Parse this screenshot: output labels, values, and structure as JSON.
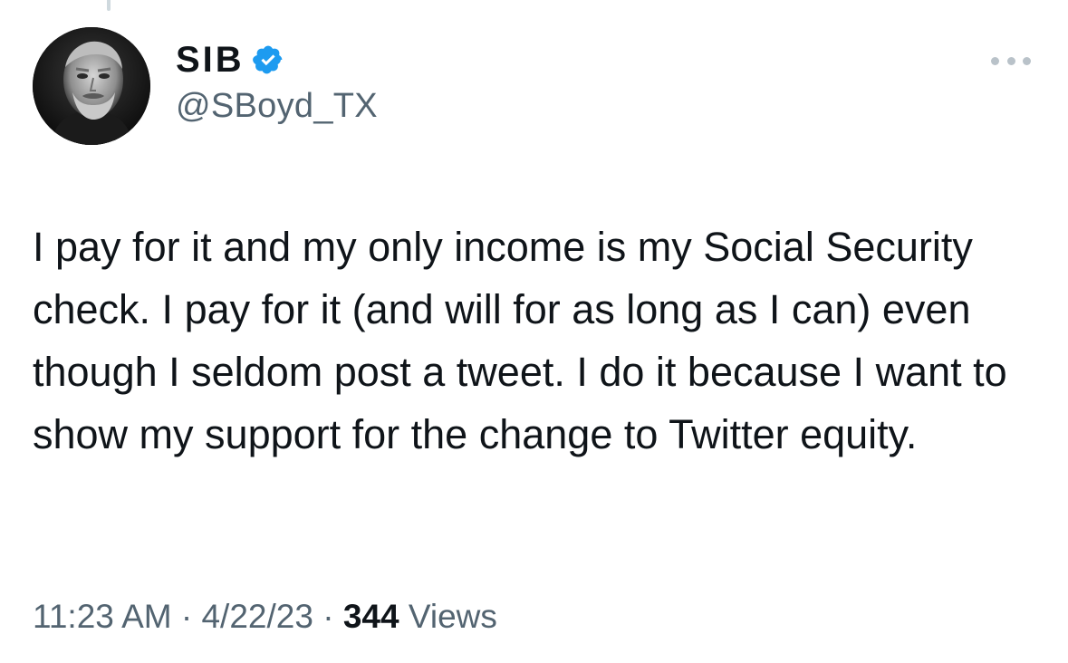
{
  "author": {
    "display_name": "SIB",
    "handle": "@SBoyd_TX",
    "verified": true,
    "avatar": "grayscale-portrait-photo"
  },
  "icons": {
    "verified": "verified-badge-icon",
    "more": "more-options-icon"
  },
  "colors": {
    "verified_badge": "#1d9bf0",
    "secondary_text": "#536471",
    "primary_text": "#0f1419"
  },
  "tweet": {
    "text": "I pay for it and my only income is my Social Security check. I pay for it (and will for as long as I can) even though I seldom post a tweet. I do it because I want to show my support for the change to Twitter equity."
  },
  "meta": {
    "time": "11:23 AM",
    "separator": "·",
    "date": "4/22/23",
    "views_count": "344",
    "views_label": "Views"
  }
}
